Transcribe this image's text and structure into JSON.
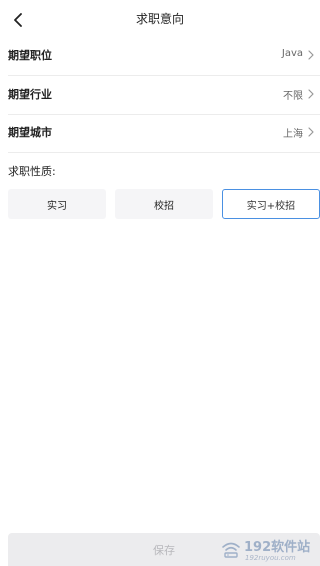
{
  "header": {
    "title": "求职意向",
    "back_icon": "chevron-left-icon"
  },
  "rows": [
    {
      "label": "期望职位",
      "value": "Java"
    },
    {
      "label": "期望行业",
      "value": "不限"
    },
    {
      "label": "期望城市",
      "value": "上海"
    }
  ],
  "job_type": {
    "title": "求职性质:",
    "options": [
      {
        "label": "实习",
        "selected": false
      },
      {
        "label": "校招",
        "selected": false
      },
      {
        "label": "实习+校招",
        "selected": true
      }
    ]
  },
  "footer": {
    "save_label": "保存"
  },
  "watermark": {
    "text": "192软件站",
    "sub": "192ruyou.com"
  },
  "colors": {
    "accent": "#4a90e2",
    "option_bg": "#f5f5f7",
    "save_bg": "#ececee"
  }
}
